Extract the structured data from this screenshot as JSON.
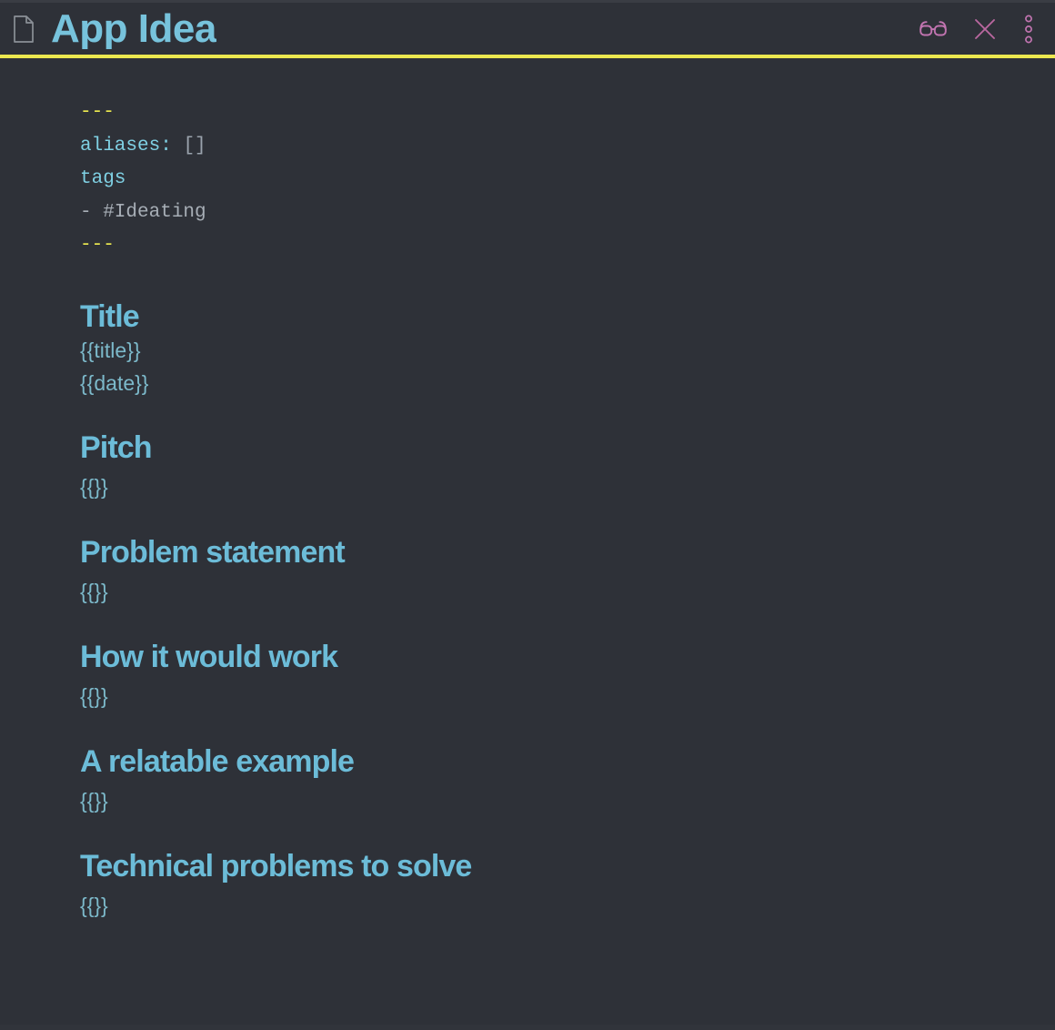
{
  "window": {
    "title": "App Idea",
    "doc_icon": "document-icon",
    "accent_color": "#ebe84f",
    "background_color": "#2e3138",
    "heading_color": "#6cbcd8",
    "body_text_color": "#7cb9ca",
    "icon_color": "#c174b0"
  },
  "titlebar": {
    "actions": [
      {
        "name": "reading-view",
        "icon": "glasses-icon",
        "label": "Reading view"
      },
      {
        "name": "close",
        "icon": "close-icon",
        "label": "Close"
      },
      {
        "name": "more-options",
        "icon": "vertical-dots-icon",
        "label": "More options"
      }
    ]
  },
  "note": {
    "frontmatter": {
      "open_delimiter": "---",
      "aliases_key": "aliases:",
      "aliases_value": "[]",
      "tags_key": "tags",
      "tag_item": "- #Ideating",
      "close_delimiter": "---"
    },
    "title_section": {
      "heading": "Title",
      "lines": [
        "{{title}}",
        "{{date}}"
      ]
    },
    "sections": [
      {
        "heading": "Pitch",
        "body": "{{}}"
      },
      {
        "heading": "Problem statement",
        "body": "{{}}"
      },
      {
        "heading": "How it would work",
        "body": "{{}}"
      },
      {
        "heading": "A relatable example",
        "body": "{{}}"
      },
      {
        "heading": "Technical problems to solve",
        "body": "{{}}"
      }
    ]
  }
}
